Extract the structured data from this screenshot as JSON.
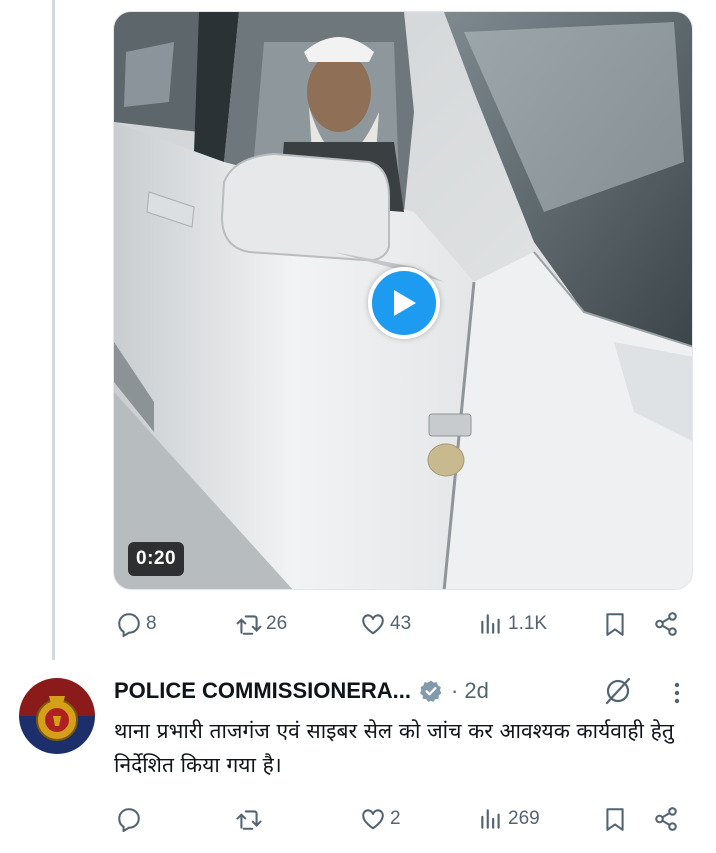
{
  "video": {
    "duration": "0:20"
  },
  "tweet1_actions": {
    "replies": "8",
    "reposts": "26",
    "likes": "43",
    "views": "1.1K"
  },
  "tweet2": {
    "author_name": "POLICE COMMISSIONERA...",
    "separator": "·",
    "age": "2d",
    "text": "थाना प्रभारी ताजगंज एवं साइबर सेल को जांच कर आवश्यक कार्यवाही हेतु निर्देशित किया गया है।",
    "actions": {
      "replies": "",
      "reposts": "",
      "likes": "2",
      "views": "269"
    }
  },
  "colors": {
    "accent": "#1d9bf0",
    "muted": "#536471",
    "text": "#0f1419",
    "divider": "#cfd9de"
  },
  "icons": [
    "reply-icon",
    "repost-icon",
    "like-icon",
    "views-icon",
    "bookmark-icon",
    "share-icon",
    "verified-icon",
    "grok-icon",
    "more-icon",
    "play-icon"
  ]
}
